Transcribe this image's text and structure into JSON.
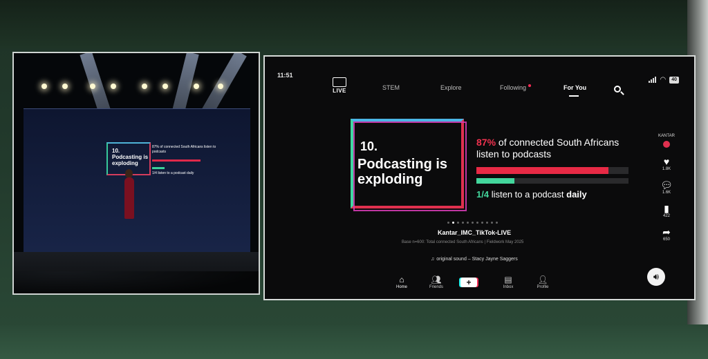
{
  "status_bar": {
    "time": "11:51",
    "battery": "40"
  },
  "top_nav": {
    "live_label": "LIVE",
    "tabs": [
      {
        "label": "STEM",
        "active": false
      },
      {
        "label": "Explore",
        "active": false
      },
      {
        "label": "Following",
        "active": false,
        "badge_dot": true
      },
      {
        "label": "For You",
        "active": true
      }
    ]
  },
  "slide": {
    "number": "10.",
    "headline": "Podcasting is exploding",
    "stat1_pct": "87%",
    "stat1_text": "of connected South Africans listen to podcasts",
    "stat1_value": 0.87,
    "stat2_fraction": "1/4",
    "stat2_text": "listen to a podcast",
    "stat2_emphasis": "daily",
    "stat2_value": 0.25
  },
  "post": {
    "creator": "Kantar_IMC_TikTok-LIVE",
    "caption": "Base n=600: Total connected South Africans | Fieldwork May 2025",
    "sound": "original sound – Stacy Jayne Saggers",
    "page_dots": 11,
    "active_dot": 1
  },
  "side_actions": {
    "brand": "KANTAR",
    "like_count": "1.8K",
    "comment_count": "1.6K",
    "save_count": "422",
    "share_count": "650"
  },
  "bottom_nav": {
    "home": "Home",
    "friends": "Friends",
    "create": "+",
    "inbox": "Inbox",
    "profile": "Profile"
  },
  "stage_slide": {
    "headline": "10. Podcasting is exploding",
    "stat1": "87% of connected South Africans listen to podcasts",
    "stat2": "1/4 listen to a podcast daily"
  },
  "colors": {
    "accent_red": "#e82a45",
    "accent_green": "#43d69c",
    "tiktok_red": "#fe2c55"
  }
}
